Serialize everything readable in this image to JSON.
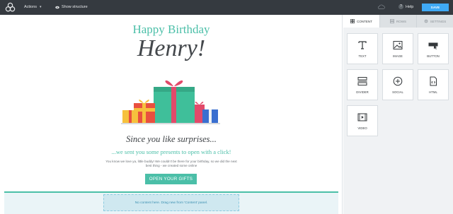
{
  "topbar": {
    "actions_label": "Actions",
    "show_structure_label": "Show structure",
    "help_label": "Help",
    "help_glyph": "?",
    "save_label": "SAVE"
  },
  "email": {
    "heading1": "Happy Birthday",
    "heading2": "Henry!",
    "heading3": "Since you like surprises...",
    "heading4": "...we sent you some presents to open with a click!",
    "paragraph": "You know we love ya, little buddy! We couldn't be there for your birthday, so we did the next best thing - we created some online",
    "cta_label": "OPEN YOUR GIFTS",
    "empty_row_text": "No content here. Drag new from 'Content' panel."
  },
  "panel": {
    "tabs": [
      {
        "label": "CONTENT",
        "icon": "grid-icon"
      },
      {
        "label": "ROWS",
        "icon": "rows-icon"
      },
      {
        "label": "SETTINGS",
        "icon": "settings-icon"
      }
    ],
    "tiles": [
      {
        "label": "TEXT",
        "icon": "text-icon"
      },
      {
        "label": "IMAGE",
        "icon": "image-icon"
      },
      {
        "label": "BUTTON",
        "icon": "button-icon"
      },
      {
        "label": "DIVIDER",
        "icon": "divider-icon"
      },
      {
        "label": "SOCIAL",
        "icon": "social-icon"
      },
      {
        "label": "HTML",
        "icon": "html-icon"
      },
      {
        "label": "VIDEO",
        "icon": "video-icon"
      }
    ]
  },
  "colors": {
    "topbar_bg": "#353a40",
    "accent": "#4bbfa8",
    "save_button": "#3fa9f5",
    "panel_bg": "#f0f2f4"
  }
}
